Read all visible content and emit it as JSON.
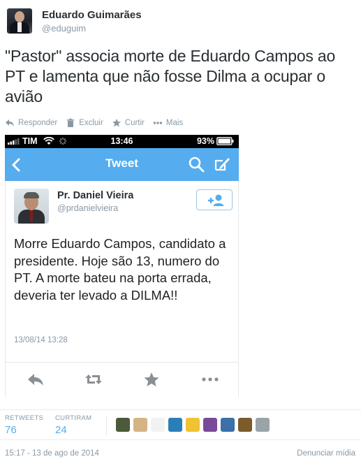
{
  "author": {
    "name": "Eduardo Guimarães",
    "handle": "@eduguim"
  },
  "tweet": {
    "text": "\"Pastor\" associa morte de Eduardo Campos ao PT e lamenta que não fosse Dilma a ocupar o avião"
  },
  "actions": {
    "reply": "Responder",
    "delete": "Excluir",
    "like": "Curtir",
    "more": "Mais"
  },
  "media": {
    "statusbar": {
      "carrier": "TIM",
      "time": "13:46",
      "battery": "93%"
    },
    "navbar_title": "Tweet",
    "embedded": {
      "name": "Pr. Daniel Vieira",
      "handle": "@prdanielvieira",
      "text": "Morre Eduardo Campos, candidato a presidente. Hoje são 13, numero do PT. A morte bateu na porta errada, deveria ter levado a DILMA!!",
      "timestamp": "13/08/14 13:28"
    }
  },
  "stats": {
    "retweets_label": "RETWEETS",
    "retweets_value": "76",
    "likes_label": "CURTIRAM",
    "likes_value": "24",
    "avatar_colors": [
      "#4a5a3a",
      "#d4b483",
      "#f2f2f2",
      "#2a7fb8",
      "#f1c232",
      "#7a4a9a",
      "#3d6fa8",
      "#7a5b2a",
      "#9aa4a8"
    ]
  },
  "footer": {
    "datetime": "15:17 - 13 de ago de 2014",
    "report": "Denunciar mídia"
  },
  "colors": {
    "accent": "#55acee",
    "muted": "#8899a6",
    "text": "#292f33"
  }
}
